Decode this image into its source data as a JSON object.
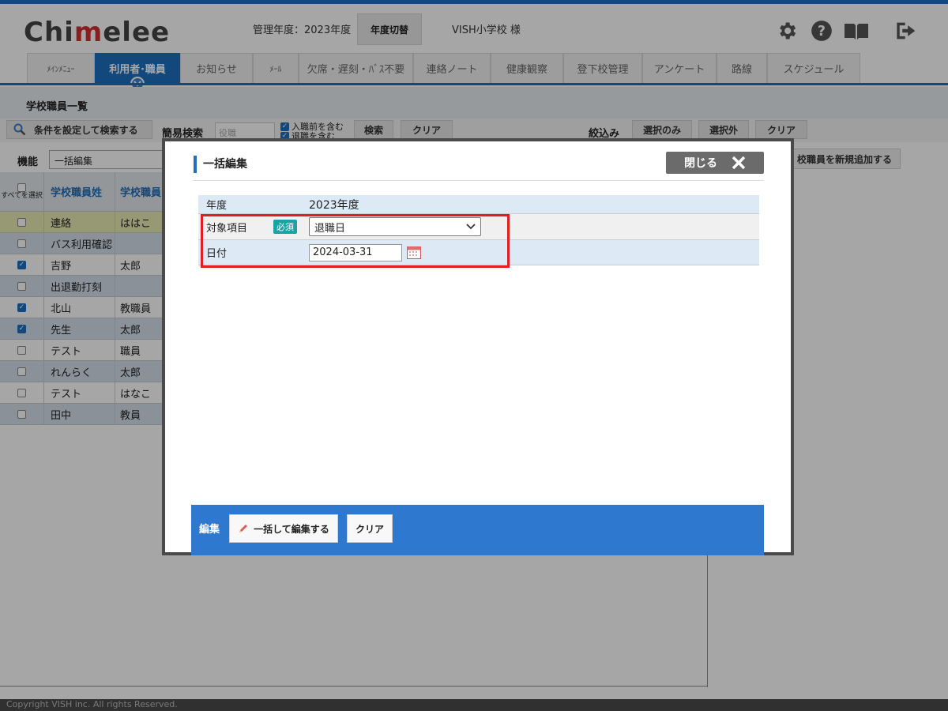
{
  "header": {
    "logo_text": "Chimelee",
    "year_text": "管理年度：2023年度",
    "year_switch": "年度切替",
    "school": "VISH小学校 様"
  },
  "nav": [
    {
      "label": "ﾒｲﾝﾒﾆｭｰ",
      "active": false
    },
    {
      "label": "利用者･職員",
      "active": true
    },
    {
      "label": "お知らせ",
      "active": false
    },
    {
      "label": "ﾒｰﾙ",
      "active": false
    },
    {
      "label": "欠席・遅刻・ﾊﾞｽ不要",
      "active": false
    },
    {
      "label": "連絡ノート",
      "active": false
    },
    {
      "label": "健康観察",
      "active": false
    },
    {
      "label": "登下校管理",
      "active": false
    },
    {
      "label": "アンケート",
      "active": false
    },
    {
      "label": "路線",
      "active": false
    },
    {
      "label": "スケジュール",
      "active": false
    }
  ],
  "page": {
    "title": "学校職員一覧",
    "search_cond": "条件を設定して検索する",
    "simple_search": "簡易検索",
    "role_placeholder": "役職",
    "chk_before": "入職前を含む",
    "chk_retired": "退職を含む",
    "search_btn": "検索",
    "clear_btn": "クリア",
    "narrow": "絞込み",
    "select_only": "選択のみ",
    "select_except": "選択外",
    "clear_btn2": "クリア",
    "func_label": "機能",
    "func_value": "一括編集",
    "add_staff": "校職員を新規追加する"
  },
  "table": {
    "select_all": "すべてを選択",
    "col_last": "学校職員姓",
    "col_first": "学校職員",
    "rows": [
      {
        "last": "連絡",
        "first": "ははこ",
        "checked": false
      },
      {
        "last": "バス利用確認",
        "first": "",
        "checked": false
      },
      {
        "last": "吉野",
        "first": "太郎",
        "checked": true
      },
      {
        "last": "出退勤打刻",
        "first": "",
        "checked": false
      },
      {
        "last": "北山",
        "first": "教職員",
        "checked": true
      },
      {
        "last": "先生",
        "first": "太郎",
        "checked": true
      },
      {
        "last": "テスト",
        "first": "職員",
        "checked": false
      },
      {
        "last": "れんらく",
        "first": "太郎",
        "checked": false
      },
      {
        "last": "テスト",
        "first": "はなこ",
        "checked": false
      },
      {
        "last": "田中",
        "first": "教員",
        "checked": false
      }
    ]
  },
  "modal": {
    "title": "一括編集",
    "close": "閉じる",
    "year_label": "年度",
    "year_value": "2023年度",
    "item_label": "対象項目",
    "required": "必須",
    "item_value": "退職日",
    "date_label": "日付",
    "date_value": "2024-03-31",
    "bottom_label": "編集",
    "edit_btn": "一括して編集する",
    "clear_btn": "クリア"
  },
  "footer": "Copyright VISH inc. All rights Reserved.",
  "colors": {
    "primary": "#1e6fbf",
    "required": "#1aa3a3",
    "highlight": "#e02020"
  }
}
